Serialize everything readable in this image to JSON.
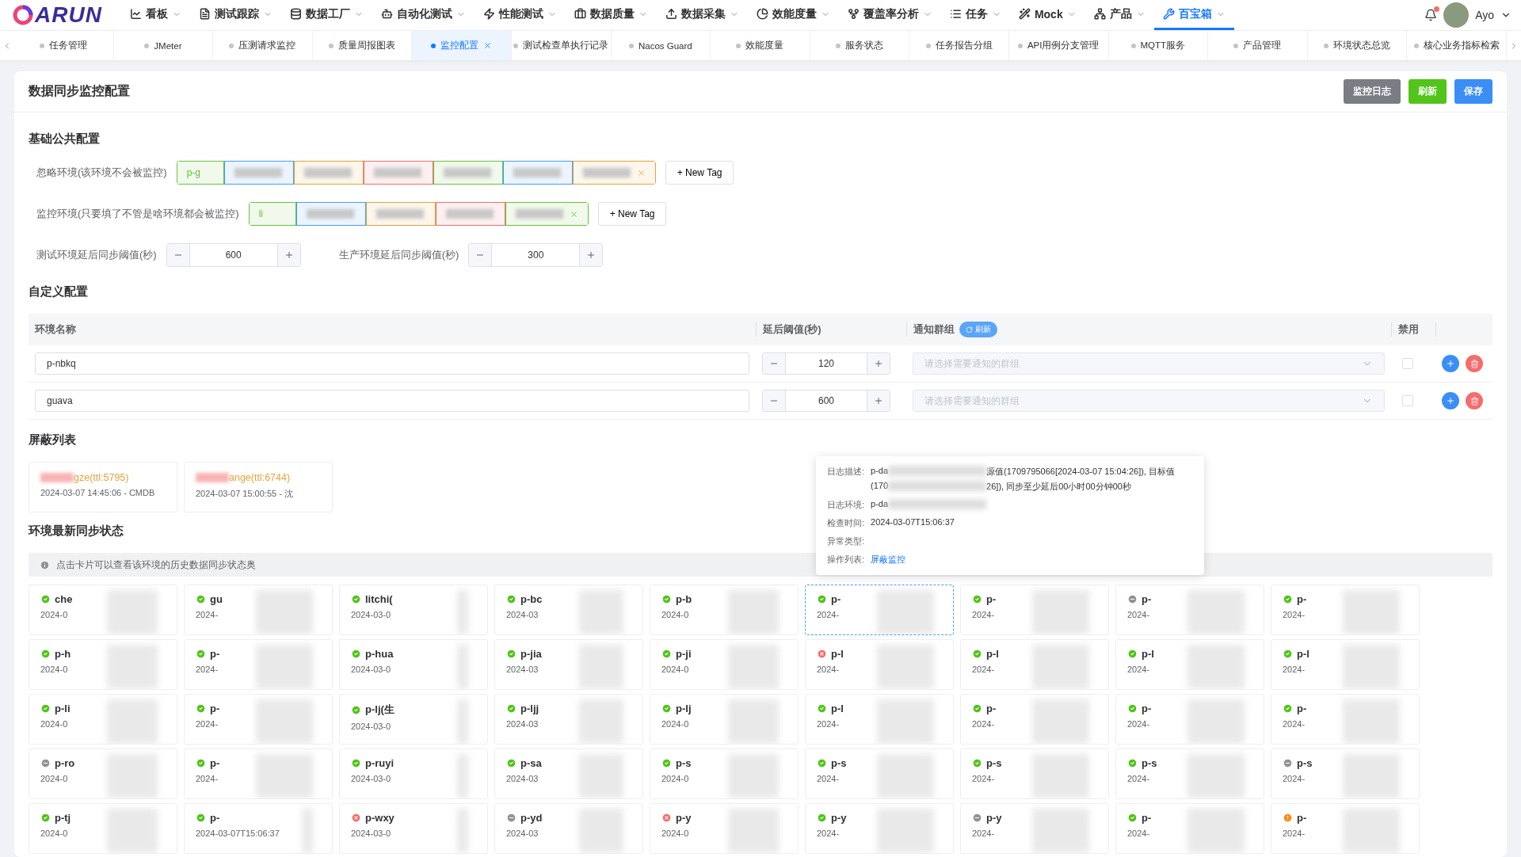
{
  "logo": {
    "text": "ARUN"
  },
  "nav": [
    {
      "label": "看板",
      "selected": false
    },
    {
      "label": "测试跟踪",
      "selected": false
    },
    {
      "label": "数据工厂",
      "selected": false
    },
    {
      "label": "自动化测试",
      "selected": false
    },
    {
      "label": "性能测试",
      "selected": false
    },
    {
      "label": "数据质量",
      "selected": false
    },
    {
      "label": "数据采集",
      "selected": false
    },
    {
      "label": "效能度量",
      "selected": false
    },
    {
      "label": "覆盖率分析",
      "selected": false
    },
    {
      "label": "任务",
      "selected": false
    },
    {
      "label": "Mock",
      "selected": false
    },
    {
      "label": "产品",
      "selected": false
    },
    {
      "label": "百宝箱",
      "selected": true
    }
  ],
  "user": {
    "name": "Ayo",
    "has_notification": true
  },
  "tabs": [
    {
      "label": "任务管理",
      "selected": false
    },
    {
      "label": "JMeter",
      "selected": false
    },
    {
      "label": "压测请求监控",
      "selected": false
    },
    {
      "label": "质量周报图表",
      "selected": false
    },
    {
      "label": "监控配置",
      "selected": true,
      "closable": true
    },
    {
      "label": "测试检查单执行记录",
      "selected": false
    },
    {
      "label": "Nacos Guard",
      "selected": false
    },
    {
      "label": "效能度量",
      "selected": false
    },
    {
      "label": "服务状态",
      "selected": false
    },
    {
      "label": "任务报告分组",
      "selected": false
    },
    {
      "label": "API用例分支管理",
      "selected": false
    },
    {
      "label": "MQTT服务",
      "selected": false
    },
    {
      "label": "产品管理",
      "selected": false
    },
    {
      "label": "环境状态总览",
      "selected": false
    },
    {
      "label": "核心业务指标检索",
      "selected": false
    }
  ],
  "page": {
    "title": "数据同步监控配置",
    "buttons": [
      {
        "label": "监控日志",
        "kind": "gray"
      },
      {
        "label": "刷新",
        "kind": "green"
      },
      {
        "label": "保存",
        "kind": "blue"
      }
    ]
  },
  "basic": {
    "title": "基础公共配置",
    "ignore": {
      "label": "忽略环境(该环境不会被监控)",
      "tags": [
        {
          "text": "p-g",
          "color": "#67c23a"
        },
        {
          "color": "#409eff"
        },
        {
          "color": "#e6a23c"
        },
        {
          "color": "#f56c6c"
        },
        {
          "color": "#67c23a"
        },
        {
          "color": "#409eff"
        },
        {
          "color": "#e6a23c",
          "closable": true
        }
      ],
      "add": "+ New Tag"
    },
    "monitor": {
      "label": "监控环境(只要填了不管是啥环境都会被监控)",
      "tags": [
        {
          "text": "li",
          "color": "#67c23a"
        },
        {
          "color": "#409eff"
        },
        {
          "color": "#e6a23c"
        },
        {
          "color": "#f56c6c"
        },
        {
          "color": "#67c23a",
          "closable": true
        }
      ],
      "add": "+ New Tag"
    },
    "thresholds": [
      {
        "label": "测试环境延后同步阈值(秒)",
        "value": "600"
      },
      {
        "label": "生产环境延后同步阈值(秒)",
        "value": "300"
      }
    ]
  },
  "custom": {
    "title": "自定义配置",
    "columns": [
      "环境名称",
      "延后阈值(秒)",
      "通知群组",
      "禁用"
    ],
    "refresh": "刷新",
    "rows": [
      {
        "name": "p-nbkq",
        "threshold": "120",
        "placeholder": "请选择需要通知的群组",
        "disabled": false
      },
      {
        "name": "guava",
        "threshold": "600",
        "placeholder": "请选择需要通知的群组",
        "disabled": false
      }
    ]
  },
  "shield": {
    "title": "屏蔽列表",
    "items": [
      {
        "name": "gze(ttl:5795)",
        "info": "2024-03-07 14:45:06 - CMDB"
      },
      {
        "name": "ange(ttl:6744)",
        "info": "2024-03-07 15:00:55 - 沈"
      }
    ]
  },
  "status": {
    "title": "环境最新同步状态",
    "hint": "点击卡片可以查看该环境的历史数据同步状态奥",
    "cards": [
      {
        "kind": "ok",
        "title": "che",
        "time": "2024-0",
        "selected": false
      },
      {
        "kind": "ok",
        "title": "gu",
        "time": "2024-",
        "selected": false
      },
      {
        "kind": "ok",
        "title": "litchi(",
        "time": "2024-03-0",
        "selected": false
      },
      {
        "kind": "ok",
        "title": "p-bc",
        "time": "2024-03",
        "selected": false
      },
      {
        "kind": "ok",
        "title": "p-b",
        "time": "2024-0",
        "selected": false
      },
      {
        "kind": "ok",
        "title": "p-",
        "time": "2024-",
        "selected": true
      },
      {
        "kind": "ok",
        "title": "p-",
        "time": "2024-",
        "selected": false
      },
      {
        "kind": "off",
        "title": "p-",
        "time": "2024-",
        "selected": false
      },
      {
        "kind": "ok",
        "title": "p-",
        "time": "2024-",
        "selected": false
      },
      {
        "kind": "ok",
        "title": "p-h",
        "time": "2024-0",
        "selected": false
      },
      {
        "kind": "ok",
        "title": "p-",
        "time": "2024-",
        "selected": false
      },
      {
        "kind": "ok",
        "title": "p-hua",
        "time": "2024-03-0",
        "selected": false
      },
      {
        "kind": "ok",
        "title": "p-jia",
        "time": "2024-03",
        "selected": false
      },
      {
        "kind": "ok",
        "title": "p-ji",
        "time": "2024-0",
        "selected": false
      },
      {
        "kind": "error",
        "title": "p-l",
        "time": "2024-",
        "selected": false
      },
      {
        "kind": "ok",
        "title": "p-l",
        "time": "2024-",
        "selected": false
      },
      {
        "kind": "ok",
        "title": "p-l",
        "time": "2024-",
        "selected": false
      },
      {
        "kind": "ok",
        "title": "p-l",
        "time": "2024-",
        "selected": false
      },
      {
        "kind": "ok",
        "title": "p-li",
        "time": "2024-0",
        "selected": false
      },
      {
        "kind": "ok",
        "title": "p-",
        "time": "2024-",
        "selected": false
      },
      {
        "kind": "ok",
        "title": "p-lj(生",
        "time": "2024-03-0",
        "selected": false
      },
      {
        "kind": "ok",
        "title": "p-ljj",
        "time": "2024-03",
        "selected": false
      },
      {
        "kind": "ok",
        "title": "p-lj",
        "time": "2024-0",
        "selected": false
      },
      {
        "kind": "ok",
        "title": "p-l",
        "time": "2024-",
        "selected": false
      },
      {
        "kind": "ok",
        "title": "p-",
        "time": "2024-",
        "selected": false
      },
      {
        "kind": "ok",
        "title": "p-",
        "time": "2024-",
        "selected": false
      },
      {
        "kind": "ok",
        "title": "p-",
        "time": "2024-",
        "selected": false
      },
      {
        "kind": "off",
        "title": "p-ro",
        "time": "2024-0",
        "selected": false
      },
      {
        "kind": "ok",
        "title": "p-",
        "time": "2024-",
        "selected": false
      },
      {
        "kind": "ok",
        "title": "p-ruyi",
        "time": "2024-03-0",
        "selected": false
      },
      {
        "kind": "ok",
        "title": "p-sa",
        "time": "2024-03",
        "selected": false
      },
      {
        "kind": "ok",
        "title": "p-s",
        "time": "2024-0",
        "selected": false
      },
      {
        "kind": "ok",
        "title": "p-s",
        "time": "2024-",
        "selected": false
      },
      {
        "kind": "ok",
        "title": "p-s",
        "time": "2024-",
        "selected": false
      },
      {
        "kind": "ok",
        "title": "p-s",
        "time": "2024-",
        "selected": false
      },
      {
        "kind": "off",
        "title": "p-s",
        "time": "2024-",
        "selected": false
      },
      {
        "kind": "ok",
        "title": "p-tj",
        "time": "2024-0",
        "selected": false
      },
      {
        "kind": "ok",
        "title": "p-",
        "time": "2024-03-07T15:06:37",
        "selected": false
      },
      {
        "kind": "error",
        "title": "p-wxy",
        "time": "2024-03-0",
        "selected": false
      },
      {
        "kind": "off",
        "title": "p-yd",
        "time": "2024-03",
        "selected": false
      },
      {
        "kind": "error",
        "title": "p-y",
        "time": "2024-0",
        "selected": false
      },
      {
        "kind": "ok",
        "title": "p-y",
        "time": "2024-",
        "selected": false
      },
      {
        "kind": "off",
        "title": "p-y",
        "time": "2024-",
        "selected": false
      },
      {
        "kind": "ok",
        "title": "p-",
        "time": "2024-",
        "selected": false
      },
      {
        "kind": "warn",
        "title": "p-",
        "time": "2024-",
        "selected": false
      }
    ]
  },
  "popover": {
    "rows": [
      {
        "label": "日志描述:",
        "lines": [
          [
            "p-da",
            "源值(1709795066[2024-03-07 15:04:26]), 目标值"
          ],
          [
            "(170",
            "26]), 同步至少延后00小时00分钟00秒"
          ]
        ]
      },
      {
        "label": "日志环境:",
        "redacted": true,
        "lines": [
          [
            "p-da"
          ]
        ]
      },
      {
        "label": "检查时间:",
        "lines": [
          [
            "2024-03-07T15:06:37"
          ]
        ]
      },
      {
        "label": "异常类型:",
        "lines": []
      },
      {
        "label": "操作列表:",
        "link": "屏蔽监控"
      }
    ]
  }
}
